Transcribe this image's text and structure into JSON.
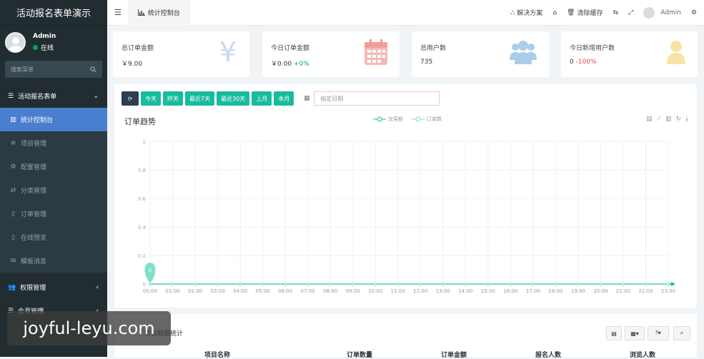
{
  "app": {
    "title": "活动报名表单演示"
  },
  "user": {
    "name": "Admin",
    "status": "在线"
  },
  "search": {
    "placeholder": "搜索菜单"
  },
  "menu": {
    "group1": "活动报名表单",
    "items": [
      {
        "label": "统计控制台",
        "icon": "bar-chart-icon"
      },
      {
        "label": "项目管理",
        "icon": "list-icon"
      },
      {
        "label": "配置管理",
        "icon": "gear-icon"
      },
      {
        "label": "分类管理",
        "icon": "random-icon"
      },
      {
        "label": "订单管理",
        "icon": "file-icon"
      },
      {
        "label": "在线预览",
        "icon": "mobile-icon"
      },
      {
        "label": "模板消息",
        "icon": "envelope-icon"
      }
    ],
    "group2": "权限管理",
    "group3": "会员管理"
  },
  "header": {
    "tab": "统计控制台",
    "solutions": "解决方案",
    "clear_cache": "清除缓存",
    "admin": "Admin"
  },
  "stats": [
    {
      "title": "总订单金额",
      "value": "￥9.00",
      "change": "",
      "icon": "yen-icon",
      "color": "#c8d9ef"
    },
    {
      "title": "今日订单金额",
      "value": "￥0.00",
      "change": "+0%",
      "icon": "calendar-icon",
      "color": "#f5b8b8"
    },
    {
      "title": "总用户数",
      "value": "735",
      "change": "",
      "icon": "users-icon",
      "color": "#a9cdea"
    },
    {
      "title": "今日新增用户数",
      "value": "0",
      "change": "-100%",
      "icon": "user-icon",
      "color": "#f8e3a6"
    }
  ],
  "toolbar": {
    "buttons": [
      "今天",
      "昨天",
      "最近7天",
      "最近30天",
      "上月",
      "本月"
    ],
    "date_placeholder": "指定日期"
  },
  "chart_data": {
    "type": "line",
    "title": "订单趋势",
    "x": [
      "00:00",
      "01:00",
      "02:00",
      "03:00",
      "04:00",
      "05:00",
      "06:00",
      "07:00",
      "08:00",
      "09:00",
      "10:00",
      "11:00",
      "12:00",
      "13:00",
      "14:00",
      "15:00",
      "16:00",
      "17:00",
      "18:00",
      "19:00",
      "20:00",
      "21:00",
      "22:00",
      "23:00"
    ],
    "series": [
      {
        "name": "交易额",
        "values": [
          0,
          0,
          0,
          0,
          0,
          0,
          0,
          0,
          0,
          0,
          0,
          0,
          0,
          0,
          0,
          0,
          0,
          0,
          0,
          0,
          0,
          0,
          0,
          0
        ],
        "color": "#18bc9c"
      },
      {
        "name": "订单数",
        "values": [
          0,
          0,
          0,
          0,
          0,
          0,
          0,
          0,
          0,
          0,
          0,
          0,
          0,
          0,
          0,
          0,
          0,
          0,
          0,
          0,
          0,
          0,
          0,
          0
        ],
        "color": "#7fe0c9"
      }
    ],
    "yticks": [
      "0",
      "0.2",
      "0.4",
      "0.6",
      "0.8",
      "1"
    ],
    "ylim": [
      0,
      1
    ],
    "marker": {
      "label": "0",
      "x": "00:00"
    },
    "grid": true,
    "legend_position": "top-center"
  },
  "bottom": {
    "title": "项目数据统计",
    "columns": [
      "项目名称",
      "订单数量",
      "订单金额",
      "报名人数",
      "浏览人数"
    ]
  },
  "watermark": "joyful-leyu.com"
}
